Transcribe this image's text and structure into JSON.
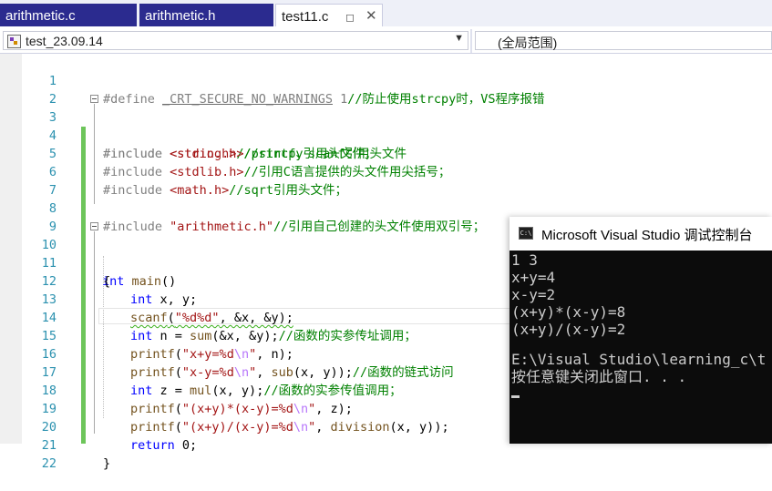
{
  "tabs": [
    {
      "label": "arithmetic.c",
      "active": false
    },
    {
      "label": "arithmetic.h",
      "active": false
    },
    {
      "label": "test11.c",
      "active": true,
      "pin_icon": "pin-icon",
      "close_glyph": "✕"
    }
  ],
  "navbar": {
    "project": "test_23.09.14",
    "scope": "(全局范围)",
    "project_icon": "project-icon",
    "dropdown_glyph": "▼"
  },
  "editor": {
    "lines": [
      {
        "num": "1"
      },
      {
        "num": "2"
      },
      {
        "num": "3"
      },
      {
        "num": "4"
      },
      {
        "num": "5"
      },
      {
        "num": "6"
      },
      {
        "num": "7"
      },
      {
        "num": "8"
      },
      {
        "num": "9"
      },
      {
        "num": "10"
      },
      {
        "num": "11"
      },
      {
        "num": "12"
      },
      {
        "num": "13"
      },
      {
        "num": "14"
      },
      {
        "num": "15"
      },
      {
        "num": "16"
      },
      {
        "num": "17"
      },
      {
        "num": "18"
      },
      {
        "num": "19"
      },
      {
        "num": "20"
      },
      {
        "num": "21"
      },
      {
        "num": "22"
      }
    ],
    "code": {
      "l1": {
        "directive": "#define",
        "macro": "_CRT_SECURE_NO_WARNINGS",
        "value": "1",
        "comment": "//防止使用strcpy时，VS程序报错"
      },
      "l3": {
        "directive": "#include",
        "header": "<stdio.h>",
        "comment": "//printf、scanf引用头文件"
      },
      "l4": {
        "directive": "#include",
        "header": "<string.h>",
        "comment": "//strcpy引用头文件；"
      },
      "l5": {
        "directive": "#include",
        "header": "<stdlib.h>",
        "comment": "//引用C语言提供的头文件用尖括号；"
      },
      "l6": {
        "directive": "#include",
        "header": "<math.h>",
        "comment": "//sqrt引用头文件；"
      },
      "l8": {
        "directive": "#include",
        "header": "\"arithmetic.h\"",
        "comment": "//引用自己创建的头文件使用双引号；"
      },
      "l10": {
        "type": "int",
        "name": "main",
        "rest": "()"
      },
      "l11": {
        "text": "{"
      },
      "l12": {
        "type": "int",
        "rest": " x, y;"
      },
      "l13": {
        "fn": "scanf",
        "open": "(",
        "str": "\"%d%d\"",
        "rest": ", &x, &y);"
      },
      "l14": {
        "type": "int",
        "rest1": " n = ",
        "fn": "sum",
        "rest2": "(&x, &y);",
        "comment": "//函数的实参传址调用；"
      },
      "l15": {
        "fn": "printf",
        "open": "(",
        "str1": "\"x+y=%d",
        "esc": "\\n",
        "str2": "\"",
        "rest": ", n);"
      },
      "l16": {
        "fn": "printf",
        "open": "(",
        "str1": "\"x-y=%d",
        "esc": "\\n",
        "str2": "\"",
        "rest1": ", ",
        "fn2": "sub",
        "rest2": "(x, y));",
        "comment": "//函数的链式访问"
      },
      "l17": {
        "type": "int",
        "rest1": " z = ",
        "fn": "mul",
        "rest2": "(x, y);",
        "comment": "//函数的实参传值调用；"
      },
      "l18": {
        "fn": "printf",
        "open": "(",
        "str1": "\"(x+y)*(x-y)=%d",
        "esc": "\\n",
        "str2": "\"",
        "rest": ", z);"
      },
      "l19": {
        "fn": "printf",
        "open": "(",
        "str1": "\"(x+y)/(x-y)=%d",
        "esc": "\\n",
        "str2": "\"",
        "rest1": ", ",
        "fn2": "division",
        "rest2": "(x, y));"
      },
      "l20": {
        "kw": "return",
        "rest": " 0;"
      },
      "l21": {
        "text": "}"
      }
    }
  },
  "console": {
    "title": "Microsoft Visual Studio 调试控制台",
    "icon_text": "C:\\",
    "lines": [
      "1 3",
      "x+y=4",
      "x-y=2",
      "(x+y)*(x-y)=8",
      "(x+y)/(x-y)=2",
      "",
      "E:\\Visual Studio\\learning_c\\t",
      "按任意键关闭此窗口. . ."
    ]
  },
  "colors": {
    "tab_inactive": "#2b2b8f",
    "line_number": "#2b91af",
    "keyword": "#0000ff",
    "comment": "#008000",
    "string": "#a31515",
    "change_bar": "#6dc55a",
    "console_bg": "#0c0c0c",
    "console_text": "#cccccc"
  }
}
